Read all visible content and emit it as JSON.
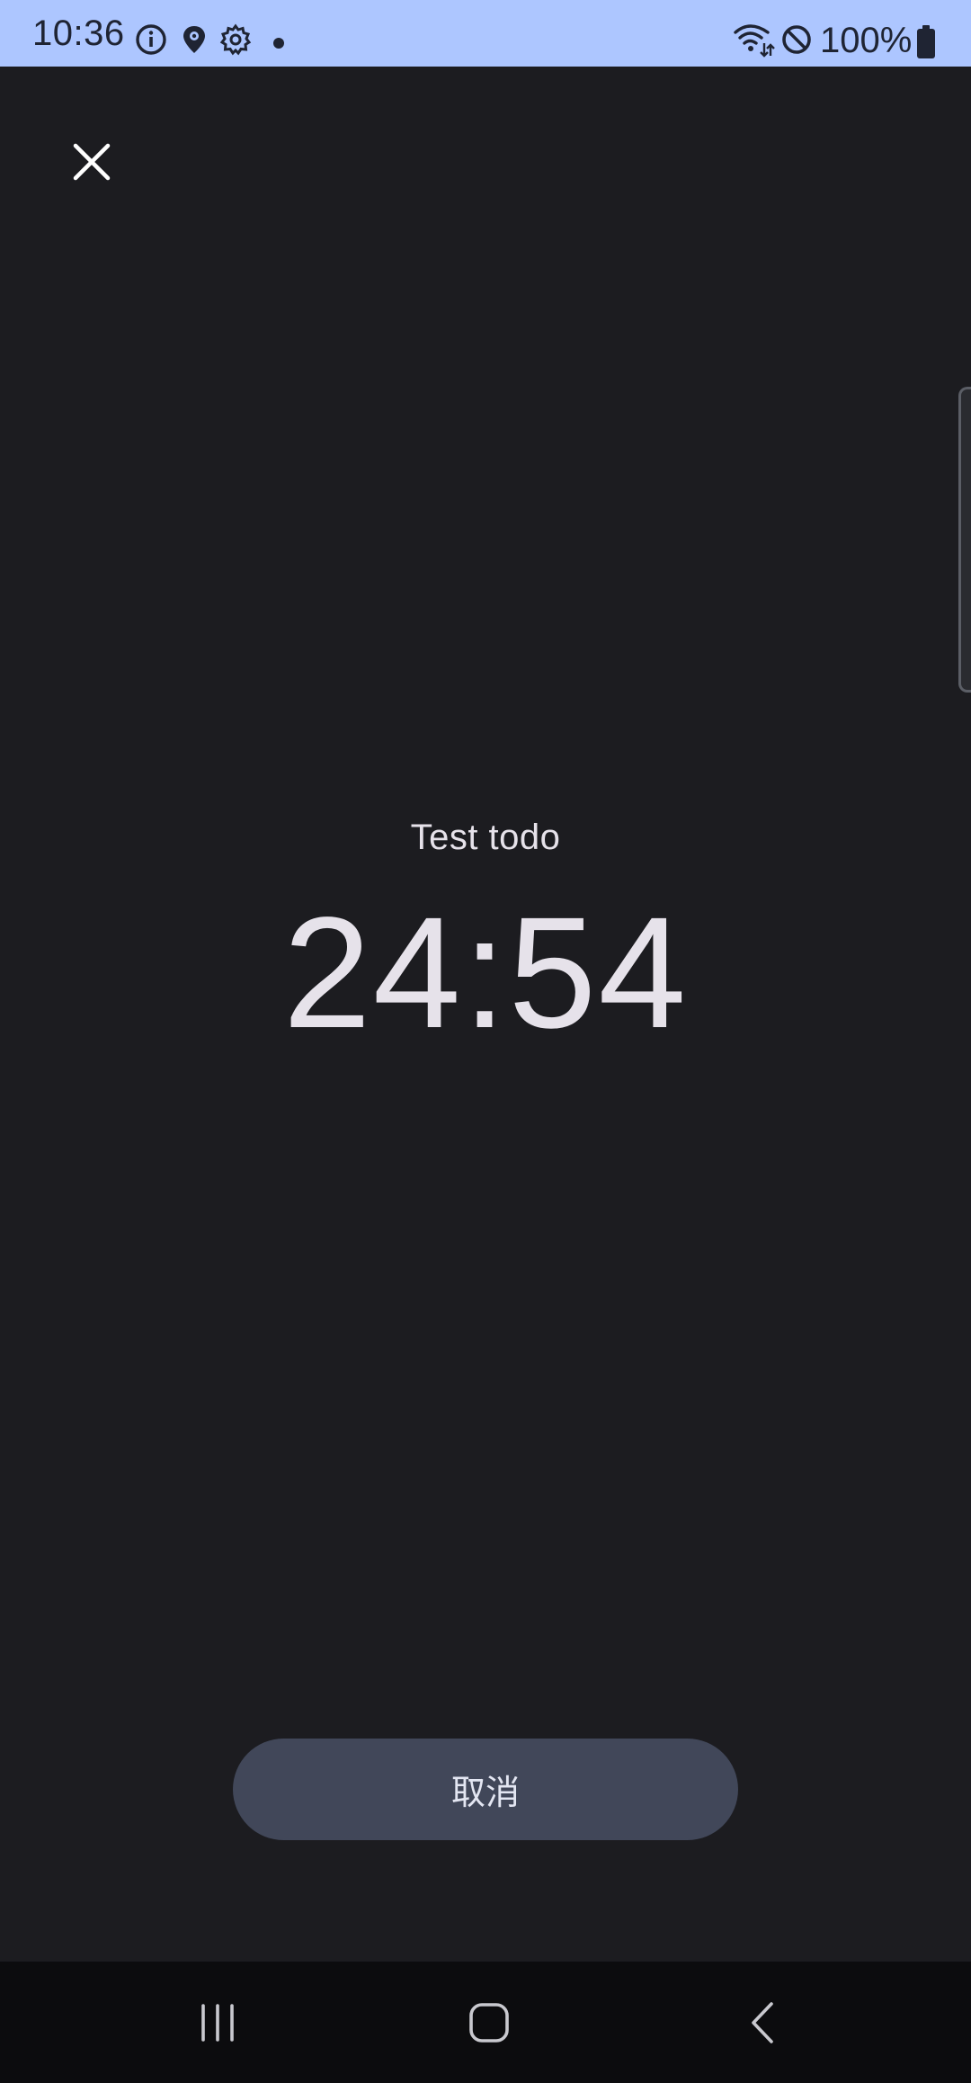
{
  "status_bar": {
    "time": "10:36",
    "battery_text": "100%",
    "background_color": "#adc6ff",
    "left_icons": [
      "info-icon",
      "location-pin-icon",
      "settings-gear-icon",
      "notification-dot-icon"
    ],
    "right_icons": [
      "wifi-icon",
      "do-not-disturb-icon",
      "battery-icon"
    ]
  },
  "header": {
    "close_icon": "close-icon"
  },
  "focus": {
    "todo_title": "Test todo",
    "timer": "24:54"
  },
  "actions": {
    "cancel_label": "取消",
    "button_color": "#414759"
  },
  "nav_bar": {
    "buttons": [
      "recent-apps-icon",
      "home-icon",
      "back-icon"
    ]
  },
  "theme": {
    "background": "#1c1c20",
    "text": "#e6e2ea"
  }
}
